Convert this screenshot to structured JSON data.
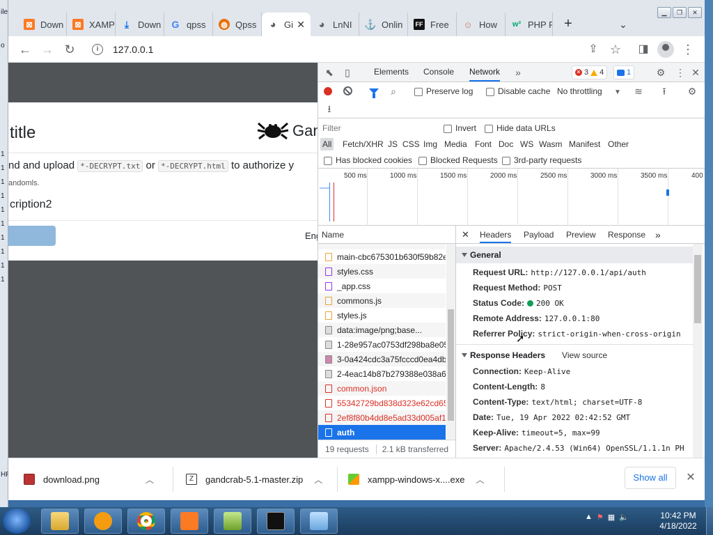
{
  "desktop": {
    "left_labels": [
      "ile",
      "o",
      "",
      "1",
      "1",
      "1",
      "1",
      "1",
      "1",
      "1",
      "1",
      "1",
      "1",
      "HP"
    ]
  },
  "browser": {
    "tabs": [
      {
        "label": "Down",
        "favicon": "xampp-icon",
        "color": "#fb7a24"
      },
      {
        "label": "XAMP",
        "favicon": "xampp-icon",
        "color": "#fb7a24"
      },
      {
        "label": "Down",
        "favicon": "download-icon",
        "color": "#1a73e8"
      },
      {
        "label": "qpss",
        "favicon": "google-icon",
        "color": "#4285f4"
      },
      {
        "label": "Qpss",
        "favicon": "site-icon",
        "color": "#e8710a"
      },
      {
        "label": "Gi",
        "favicon": "globe-icon",
        "color": "#5f6368",
        "active": true
      },
      {
        "label": "LnNI",
        "favicon": "globe-icon",
        "color": "#5f6368"
      },
      {
        "label": "Onlin",
        "favicon": "anchor-icon",
        "color": "#e8a33d"
      },
      {
        "label": "Free",
        "favicon": "ff-icon",
        "color": "#111"
      },
      {
        "label": "How",
        "favicon": "person-icon",
        "color": "#c77d5a"
      },
      {
        "label": "PHP F",
        "favicon": "w3-icon",
        "color": "#04aa6d"
      }
    ],
    "url": "127.0.0.1"
  },
  "page": {
    "title": "title",
    "brand": "Gan",
    "body1_prefix": "nd and upload",
    "code1": "*-DECRYPT.txt",
    "body1_or": "or",
    "code2": "*-DECRYPT.html",
    "body1_suffix": "to authorize y",
    "body2": "andomls.",
    "body3": "cription2",
    "lang": "Eng"
  },
  "devtools": {
    "tabs": [
      "Elements",
      "Console",
      "Network"
    ],
    "errors": "3",
    "warnings": "4",
    "messages": "1",
    "toolbar": {
      "preserve_log": "Preserve log",
      "disable_cache": "Disable cache",
      "throttling": "No throttling"
    },
    "filter": {
      "placeholder": "Filter",
      "invert": "Invert",
      "hide_data_urls": "Hide data URLs",
      "types": [
        "All",
        "Fetch/XHR",
        "JS",
        "CSS",
        "Img",
        "Media",
        "Font",
        "Doc",
        "WS",
        "Wasm",
        "Manifest",
        "Other"
      ],
      "blocked_cookies": "Has blocked cookies",
      "blocked_requests": "Blocked Requests",
      "third_party": "3rd-party requests"
    },
    "timeline_ticks": [
      "500 ms",
      "1000 ms",
      "1500 ms",
      "2000 ms",
      "2500 ms",
      "3000 ms",
      "3500 ms",
      "400"
    ],
    "requests": {
      "header": "Name",
      "rows": [
        {
          "name": "main-cbc675301b630f59b82e",
          "kind": "js"
        },
        {
          "name": "styles.css",
          "kind": "css"
        },
        {
          "name": "_app.css",
          "kind": "css"
        },
        {
          "name": "commons.js",
          "kind": "js"
        },
        {
          "name": "styles.js",
          "kind": "js"
        },
        {
          "name": "data:image/png;base...",
          "kind": "img"
        },
        {
          "name": "1-28e957ac0753df298ba8e05",
          "kind": "img"
        },
        {
          "name": "3-0a424cdc3a75fcccd0ea4db",
          "kind": "img"
        },
        {
          "name": "2-4eac14b87b279388e038a6",
          "kind": "img"
        },
        {
          "name": "common.json",
          "kind": "err"
        },
        {
          "name": "55342729bd838d323e62cd65",
          "kind": "err"
        },
        {
          "name": "2ef8f80b4dd8e5ad33d005af1",
          "kind": "err"
        },
        {
          "name": "auth",
          "kind": "sel"
        }
      ],
      "status_count": "19 requests",
      "status_transferred": "2.1 kB transferred"
    },
    "detail": {
      "tabs": [
        "Headers",
        "Payload",
        "Preview",
        "Response"
      ],
      "general_title": "General",
      "general": [
        {
          "k": "Request URL:",
          "v": "http://127.0.0.1/api/auth"
        },
        {
          "k": "Request Method:",
          "v": "POST"
        },
        {
          "k": "Status Code:",
          "v": "200 OK"
        },
        {
          "k": "Remote Address:",
          "v": "127.0.0.1:80"
        },
        {
          "k": "Referrer Policy:",
          "v": "strict-origin-when-cross-origin"
        }
      ],
      "response_title": "Response Headers",
      "view_source": "View source",
      "response": [
        {
          "k": "Connection:",
          "v": "Keep-Alive"
        },
        {
          "k": "Content-Length:",
          "v": "8"
        },
        {
          "k": "Content-Type:",
          "v": "text/html; charset=UTF-8"
        },
        {
          "k": "Date:",
          "v": "Tue, 19 Apr 2022 02:42:52 GMT"
        },
        {
          "k": "Keep-Alive:",
          "v": "timeout=5, max=99"
        },
        {
          "k": "Server:",
          "v": "Apache/2.4.53 (Win64) OpenSSL/1.1.1n PH"
        }
      ]
    }
  },
  "downloads": {
    "items": [
      "download.png",
      "gandcrab-5.1-master.zip",
      "xampp-windows-x....exe"
    ],
    "show_all": "Show all"
  },
  "taskbar": {
    "time": "10:42 PM",
    "date": "4/18/2022"
  }
}
